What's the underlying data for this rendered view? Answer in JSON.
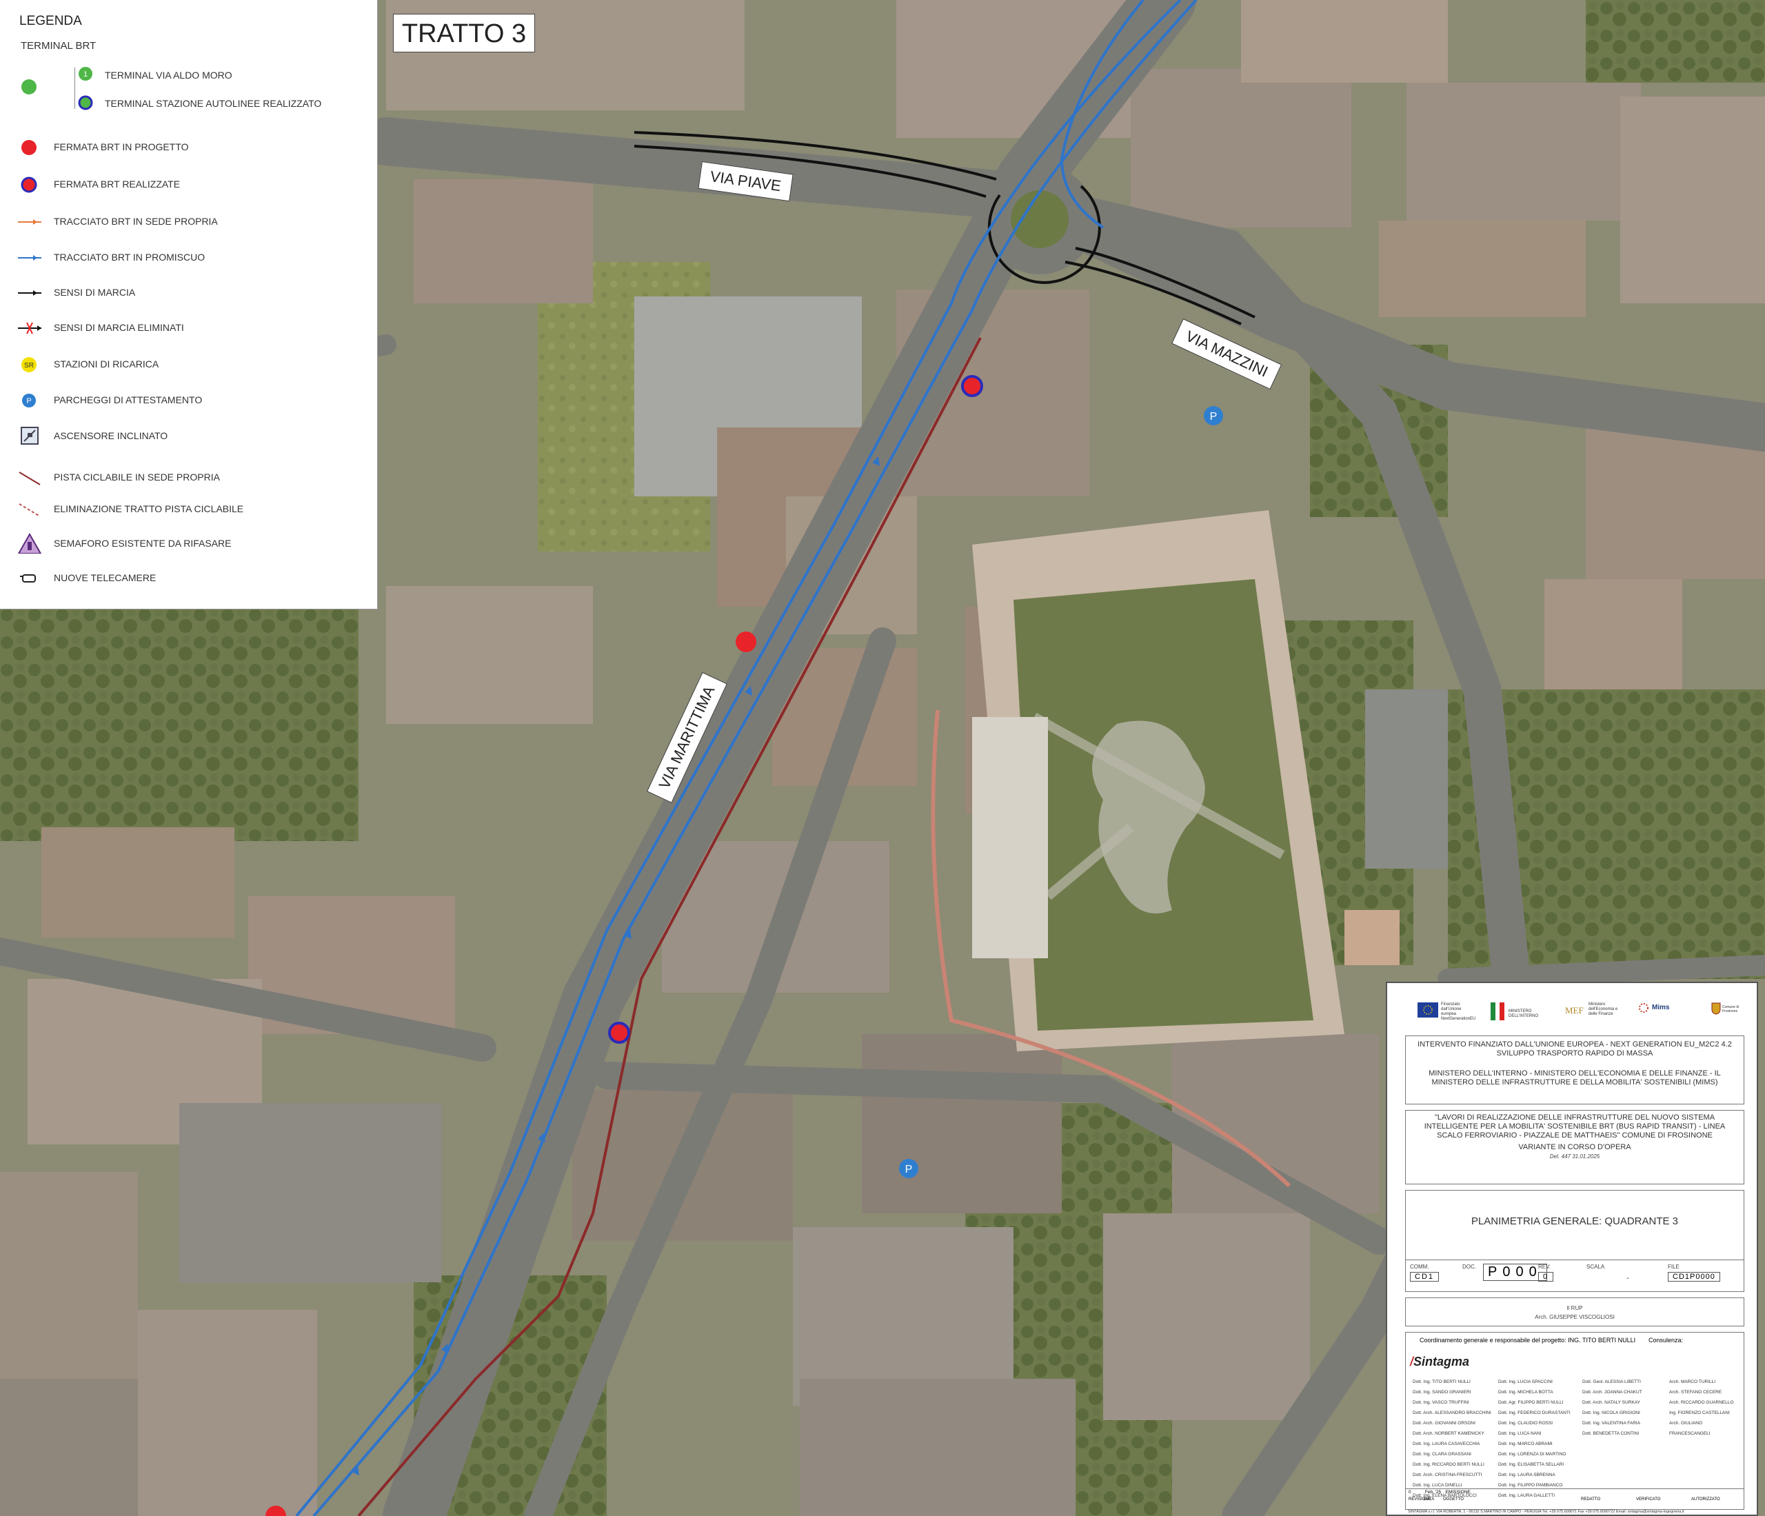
{
  "legend": {
    "title": "LEGENDA",
    "subtitle": "TERMINAL BRT",
    "terminal_number": "1",
    "items": [
      {
        "label": "TERMINAL VIA ALDO MORO",
        "icon": "green-number-dot-icon"
      },
      {
        "label": "TERMINAL STAZIONE AUTOLINEE REALIZZATO",
        "icon": "blue-ring-green-dot-icon"
      },
      {
        "label": "FERMATA BRT IN PROGETTO",
        "icon": "red-dot-icon"
      },
      {
        "label": "FERMATA BRT REALIZZATE",
        "icon": "red-dot-blue-ring-icon"
      },
      {
        "label": "TRACCIATO BRT IN SEDE PROPRIA",
        "icon": "orange-line-arrow-icon"
      },
      {
        "label": "TRACCIATO BRT IN PROMISCUO",
        "icon": "blue-line-arrow-icon"
      },
      {
        "label": "SENSI DI MARCIA",
        "icon": "black-line-arrow-icon"
      },
      {
        "label": "SENSI DI MARCIA ELIMINATI",
        "icon": "crossed-arrow-icon"
      },
      {
        "label": "STAZIONI DI RICARICA",
        "icon": "charging-station-icon",
        "badge": "SR"
      },
      {
        "label": "PARCHEGGI DI ATTESTAMENTO",
        "icon": "parking-icon",
        "badge": "P"
      },
      {
        "label": "ASCENSORE INCLINATO",
        "icon": "inclined-lift-icon"
      },
      {
        "label": "PISTA CICLABILE IN SEDE PROPRIA",
        "icon": "bike-lane-icon"
      },
      {
        "label": "ELIMINAZIONE TRATTO PISTA CICLABILE",
        "icon": "dashed-bike-lane-icon"
      },
      {
        "label": "SEMAFORO ESISTENTE DA RIFASARE",
        "icon": "traffic-light-icon"
      },
      {
        "label": "NUOVE TELECAMERE",
        "icon": "camera-icon"
      }
    ]
  },
  "map": {
    "tratto_label": "TRATTO 3",
    "streets": [
      "VIA PIAVE",
      "VIA MAZZINI",
      "VIA MARITTIMA"
    ],
    "parking_badge": "P",
    "colors": {
      "brt_line": "#2f74c9",
      "bike_lane": "#8b2a2a",
      "stop_red": "#e8242a",
      "ring_blue": "#2b2bb8",
      "parking": "#2f7fd0",
      "legend_orange": "#e87a3a"
    }
  },
  "title_block": {
    "logos": {
      "eu": "Finanziato dall'Unione europea NextGenerationEU",
      "interno": "MINISTERO DELL'INTERNO",
      "mef": "Ministero dell'Economia e delle Finanze",
      "mims": "Mims",
      "comune": "Comune di Frosinone"
    },
    "funding_1": "INTERVENTO FINANZIATO DALL'UNIONE EUROPEA - NEXT GENERATION EU_M2C2 4.2",
    "funding_2": "SVILUPPO TRASPORTO RAPIDO DI MASSA",
    "ministries": "MINISTERO DELL'INTERNO - MINISTERO DELL'ECONOMIA E DELLE FINANZE - IL MINISTERO DELLE INFRASTRUTTURE E DELLA MOBILITA' SOSTENIBILI (MIMS)",
    "project_title": "\"LAVORI DI REALIZZAZIONE DELLE INFRASTRUTTURE DEL NUOVO SISTEMA INTELLIGENTE PER LA MOBILITA' SOSTENIBILE BRT (BUS RAPID TRANSIT) - LINEA SCALO FERROVIARIO - PIAZZALE DE MATTHAEIS\" COMUNE DI FROSINONE",
    "variant": "VARIANTE IN CORSO D'OPERA",
    "variant_note": "Det. 447 31.01.2025",
    "drawing_title": "PLANIMETRIA GENERALE: QUADRANTE 3",
    "fields": {
      "comm_label": "COMM.",
      "comm": "CD1",
      "doc_label": "DOC.",
      "doc": "P000",
      "rev_label": "REV.",
      "rev": "0",
      "scala_label": "SCALA",
      "scala": "-",
      "file_label": "FILE",
      "file": "CD1P0000"
    },
    "rup_label": "Il RUP",
    "rup_name": "Arch. GIUSEPPE VISCOGLIOSI",
    "coordinator": "Coordinamento generale e responsabile del progetto:  ING. TITO BERTI NULLI",
    "consultancy": "Consulenza:",
    "company": "Sintagma",
    "staff_col1": [
      "Dott. Ing. TITO BERTI NULLI",
      "Dott. Ing. SANDO GRANIERI",
      "Dott. Ing. VASCO TRUFFINI",
      "Dott. Arch. ALESSANDRO BRACCHINI",
      "Dott. Arch. GIOVANNI ORSONI",
      "Dott. Arch. NORBERT KAMENICKY",
      "Dott. Ing. LAURA CASAVECCHIA",
      "Dott. Ing. CLARA GRASSANI",
      "Dott. Ing. RICCARDO BERTI NULLI",
      "Dott. Arch. CRISTINA FRESCUTTI",
      "Dott. Ing. LUCA DINELLI",
      "Dott. Ing. ELENA BARTOLOCCI"
    ],
    "staff_col2": [
      "Dott. Ing. LUCIA SPACCINI",
      "Dott. Ing. MICHELA BOTTA",
      "Dott. Agr. FILIPPO BERTI NULLI",
      "Dott. Ing. FEDERICO DURASTANTI",
      "Dott. Ing. CLAUDIO ROSSI",
      "Dott. Ing. LUCA NANI",
      "Dott. Ing. MARCO ABRAMI",
      "Dott. Ing. LORENZA DI MARTINO",
      "Dott. Ing. ELISABETTA SELLARI",
      "Dott. Ing. LAURA SBRENNA",
      "Dott. Ing. FILIPPO PAMBIANCO",
      "Dott. Ing. LAURA GALLETTI"
    ],
    "staff_col3": [
      "Dott. Geol. ALESSIA LIBETTI",
      "Dott. Arch. JOANNA CHAKUT",
      "Dott. Arch. NATALY SURKAY",
      "Dott. Ing. NICOLA GRIGIONI",
      "Dott. Ing. VALENTINA FARIA",
      "Dott. BENEDETTA CONTINI"
    ],
    "staff_col4": [
      "Arch. MARCO TURILLI",
      "Arch. STEFANO CECERE",
      "Arch. RICCARDO GUARNELLO",
      "Ing. FIORENZO CASTELLANI",
      "Arch. GIULIANO FRANCESCANGELI"
    ],
    "rev_row": {
      "n": "0",
      "date": "Feb. '25",
      "desc": "EMISSIONE"
    },
    "rev_headers": [
      "REVISIONE",
      "DATA",
      "OGGETTO",
      "REDATTO",
      "VERIFICATO",
      "AUTORIZZATO"
    ],
    "footer": "SINTAGMA s.r.l.   VIA ROBERTA, 1 - 06132  S.MARTINO IN CAMPO - PERUGIA    Tel. +39 075.609071    Fax +39 075.6090722    Email: sintagma@sintagma-ingegneria.it"
  }
}
